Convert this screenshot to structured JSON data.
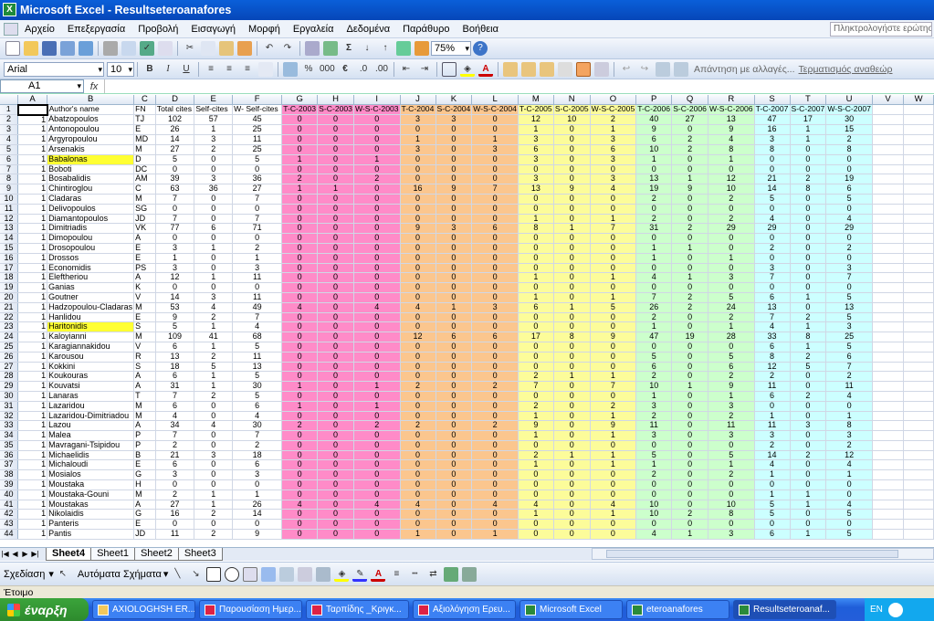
{
  "title": "Microsoft Excel - Resultseteroanafores",
  "menu": [
    "Αρχείο",
    "Επεξεργασία",
    "Προβολή",
    "Εισαγωγή",
    "Μορφή",
    "Εργαλεία",
    "Δεδομένα",
    "Παράθυρο",
    "Βοήθεια"
  ],
  "help_placeholder": "Πληκτρολογήστε ερώτηση",
  "zoom": "75%",
  "font_name": "Arial",
  "font_size": "10",
  "reply_text": "Απάντηση με αλλαγές...",
  "end_review": "Τερματισμός αναθεώρ",
  "namebox": "A1",
  "fx": "fx",
  "columns": [
    "A",
    "B",
    "C",
    "D",
    "E",
    "F",
    "G",
    "H",
    "I",
    "J",
    "K",
    "L",
    "M",
    "N",
    "O",
    "P",
    "Q",
    "R",
    "S",
    "T",
    "U",
    "V",
    "W"
  ],
  "header_row": [
    "",
    "Author's name",
    "FN",
    "Total cites",
    "Self-cites",
    "W-  Self-cites",
    "T-C-2003",
    "S-C-2003",
    "W-S-C-2003",
    "T-C-2004",
    "S-C-2004",
    "W-S-C-2004",
    "T-C-2005",
    "S-C-2005",
    "W-S-C-2005",
    "T-C-2006",
    "S-C-2006",
    "W-S-C-2006",
    "T-C-2007",
    "S-C-2007",
    "W-S-C-2007",
    "",
    ""
  ],
  "rows": [
    [
      "1",
      "Abatzopoulos",
      "TJ",
      "102",
      "57",
      "45",
      "0",
      "0",
      "0",
      "3",
      "3",
      "0",
      "12",
      "10",
      "2",
      "40",
      "27",
      "13",
      "47",
      "17",
      "30"
    ],
    [
      "1",
      "Antonopoulou",
      "E",
      "26",
      "1",
      "25",
      "0",
      "0",
      "0",
      "0",
      "0",
      "0",
      "1",
      "0",
      "1",
      "9",
      "0",
      "9",
      "16",
      "1",
      "15"
    ],
    [
      "1",
      "Argyropoulou",
      "MD",
      "14",
      "3",
      "11",
      "0",
      "0",
      "0",
      "1",
      "0",
      "1",
      "3",
      "0",
      "3",
      "6",
      "2",
      "4",
      "3",
      "1",
      "2"
    ],
    [
      "1",
      "Arsenakis",
      "M",
      "27",
      "2",
      "25",
      "0",
      "0",
      "0",
      "3",
      "0",
      "3",
      "6",
      "0",
      "6",
      "10",
      "2",
      "8",
      "8",
      "0",
      "8"
    ],
    [
      "1",
      "Babalonas",
      "D",
      "5",
      "0",
      "5",
      "1",
      "0",
      "1",
      "0",
      "0",
      "0",
      "3",
      "0",
      "3",
      "1",
      "0",
      "1",
      "0",
      "0",
      "0"
    ],
    [
      "1",
      "Boboti",
      "DC",
      "0",
      "0",
      "0",
      "0",
      "0",
      "0",
      "0",
      "0",
      "0",
      "0",
      "0",
      "0",
      "0",
      "0",
      "0",
      "0",
      "0",
      "0"
    ],
    [
      "1",
      "Bosabalidis",
      "AM",
      "39",
      "3",
      "36",
      "2",
      "0",
      "2",
      "0",
      "0",
      "0",
      "3",
      "0",
      "3",
      "13",
      "1",
      "12",
      "21",
      "2",
      "19"
    ],
    [
      "1",
      "Chintiroglou",
      "C",
      "63",
      "36",
      "27",
      "1",
      "1",
      "0",
      "16",
      "9",
      "7",
      "13",
      "9",
      "4",
      "19",
      "9",
      "10",
      "14",
      "8",
      "6"
    ],
    [
      "1",
      "Cladaras",
      "M",
      "7",
      "0",
      "7",
      "0",
      "0",
      "0",
      "0",
      "0",
      "0",
      "0",
      "0",
      "0",
      "2",
      "0",
      "2",
      "5",
      "0",
      "5"
    ],
    [
      "1",
      "Delivopoulos",
      "SG",
      "0",
      "0",
      "0",
      "0",
      "0",
      "0",
      "0",
      "0",
      "0",
      "0",
      "0",
      "0",
      "0",
      "0",
      "0",
      "0",
      "0",
      "0"
    ],
    [
      "1",
      "Diamantopoulos",
      "JD",
      "7",
      "0",
      "7",
      "0",
      "0",
      "0",
      "0",
      "0",
      "0",
      "1",
      "0",
      "1",
      "2",
      "0",
      "2",
      "4",
      "0",
      "4"
    ],
    [
      "1",
      "Dimitriadis",
      "VK",
      "77",
      "6",
      "71",
      "0",
      "0",
      "0",
      "9",
      "3",
      "6",
      "8",
      "1",
      "7",
      "31",
      "2",
      "29",
      "29",
      "0",
      "29"
    ],
    [
      "1",
      "Dimopoulou",
      "A",
      "0",
      "0",
      "0",
      "0",
      "0",
      "0",
      "0",
      "0",
      "0",
      "0",
      "0",
      "0",
      "0",
      "0",
      "0",
      "0",
      "0",
      "0"
    ],
    [
      "1",
      "Drosopoulou",
      "E",
      "3",
      "1",
      "2",
      "0",
      "0",
      "0",
      "0",
      "0",
      "0",
      "0",
      "0",
      "0",
      "1",
      "1",
      "0",
      "2",
      "0",
      "2"
    ],
    [
      "1",
      "Drossos",
      "E",
      "1",
      "0",
      "1",
      "0",
      "0",
      "0",
      "0",
      "0",
      "0",
      "0",
      "0",
      "0",
      "1",
      "0",
      "1",
      "0",
      "0",
      "0"
    ],
    [
      "1",
      "Economidis",
      "PS",
      "3",
      "0",
      "3",
      "0",
      "0",
      "0",
      "0",
      "0",
      "0",
      "0",
      "0",
      "0",
      "0",
      "0",
      "0",
      "3",
      "0",
      "3"
    ],
    [
      "1",
      "Eleftheriou",
      "A",
      "12",
      "1",
      "11",
      "0",
      "0",
      "0",
      "0",
      "0",
      "0",
      "1",
      "0",
      "1",
      "4",
      "1",
      "3",
      "7",
      "0",
      "7"
    ],
    [
      "1",
      "Ganias",
      "K",
      "0",
      "0",
      "0",
      "0",
      "0",
      "0",
      "0",
      "0",
      "0",
      "0",
      "0",
      "0",
      "0",
      "0",
      "0",
      "0",
      "0",
      "0"
    ],
    [
      "1",
      "Goutner",
      "V",
      "14",
      "3",
      "11",
      "0",
      "0",
      "0",
      "0",
      "0",
      "0",
      "1",
      "0",
      "1",
      "7",
      "2",
      "5",
      "6",
      "1",
      "5"
    ],
    [
      "1",
      "Hadzopoulou-Cladaras",
      "M",
      "53",
      "4",
      "49",
      "4",
      "0",
      "4",
      "4",
      "1",
      "3",
      "6",
      "1",
      "5",
      "26",
      "2",
      "24",
      "13",
      "0",
      "13"
    ],
    [
      "1",
      "Hanlidou",
      "E",
      "9",
      "2",
      "7",
      "0",
      "0",
      "0",
      "0",
      "0",
      "0",
      "0",
      "0",
      "0",
      "2",
      "0",
      "2",
      "7",
      "2",
      "5"
    ],
    [
      "1",
      "Haritonidis",
      "S",
      "5",
      "1",
      "4",
      "0",
      "0",
      "0",
      "0",
      "0",
      "0",
      "0",
      "0",
      "0",
      "1",
      "0",
      "1",
      "4",
      "1",
      "3"
    ],
    [
      "1",
      "Kaloyianni",
      "M",
      "109",
      "41",
      "68",
      "0",
      "0",
      "0",
      "12",
      "6",
      "6",
      "17",
      "8",
      "9",
      "47",
      "19",
      "28",
      "33",
      "8",
      "25"
    ],
    [
      "1",
      "Karagiannakidou",
      "V",
      "6",
      "1",
      "5",
      "0",
      "0",
      "0",
      "0",
      "0",
      "0",
      "0",
      "0",
      "0",
      "0",
      "0",
      "0",
      "6",
      "1",
      "5"
    ],
    [
      "1",
      "Karousou",
      "R",
      "13",
      "2",
      "11",
      "0",
      "0",
      "0",
      "0",
      "0",
      "0",
      "0",
      "0",
      "0",
      "5",
      "0",
      "5",
      "8",
      "2",
      "6"
    ],
    [
      "1",
      "Kokkini",
      "S",
      "18",
      "5",
      "13",
      "0",
      "0",
      "0",
      "0",
      "0",
      "0",
      "0",
      "0",
      "0",
      "6",
      "0",
      "6",
      "12",
      "5",
      "7"
    ],
    [
      "1",
      "Koukouras",
      "A",
      "6",
      "1",
      "5",
      "0",
      "0",
      "0",
      "0",
      "0",
      "0",
      "2",
      "1",
      "1",
      "2",
      "0",
      "2",
      "2",
      "0",
      "2"
    ],
    [
      "1",
      "Kouvatsi",
      "A",
      "31",
      "1",
      "30",
      "1",
      "0",
      "1",
      "2",
      "0",
      "2",
      "7",
      "0",
      "7",
      "10",
      "1",
      "9",
      "11",
      "0",
      "11"
    ],
    [
      "1",
      "Lanaras",
      "T",
      "7",
      "2",
      "5",
      "0",
      "0",
      "0",
      "0",
      "0",
      "0",
      "0",
      "0",
      "0",
      "1",
      "0",
      "1",
      "6",
      "2",
      "4"
    ],
    [
      "1",
      "Lazaridou",
      "M",
      "6",
      "0",
      "6",
      "1",
      "0",
      "1",
      "0",
      "0",
      "0",
      "2",
      "0",
      "2",
      "3",
      "0",
      "3",
      "0",
      "0",
      "0"
    ],
    [
      "1",
      "Lazaridou-Dimitriadou",
      "M",
      "4",
      "0",
      "4",
      "0",
      "0",
      "0",
      "0",
      "0",
      "0",
      "1",
      "0",
      "1",
      "2",
      "0",
      "2",
      "1",
      "0",
      "1"
    ],
    [
      "1",
      "Lazou",
      "A",
      "34",
      "4",
      "30",
      "2",
      "0",
      "2",
      "2",
      "0",
      "2",
      "9",
      "0",
      "9",
      "11",
      "0",
      "11",
      "11",
      "3",
      "8"
    ],
    [
      "1",
      "Malea",
      "P",
      "7",
      "0",
      "7",
      "0",
      "0",
      "0",
      "0",
      "0",
      "0",
      "1",
      "0",
      "1",
      "3",
      "0",
      "3",
      "3",
      "0",
      "3"
    ],
    [
      "1",
      "Mavragani-Tsipidou",
      "P",
      "2",
      "0",
      "2",
      "0",
      "0",
      "0",
      "0",
      "0",
      "0",
      "0",
      "0",
      "0",
      "0",
      "0",
      "0",
      "2",
      "0",
      "2"
    ],
    [
      "1",
      "Michaelidis",
      "B",
      "21",
      "3",
      "18",
      "0",
      "0",
      "0",
      "0",
      "0",
      "0",
      "2",
      "1",
      "1",
      "5",
      "0",
      "5",
      "14",
      "2",
      "12"
    ],
    [
      "1",
      "Michaloudi",
      "E",
      "6",
      "0",
      "6",
      "0",
      "0",
      "0",
      "0",
      "0",
      "0",
      "1",
      "0",
      "1",
      "1",
      "0",
      "1",
      "4",
      "0",
      "4"
    ],
    [
      "1",
      "Mosialos",
      "G",
      "3",
      "0",
      "3",
      "0",
      "0",
      "0",
      "0",
      "0",
      "0",
      "0",
      "0",
      "0",
      "2",
      "0",
      "2",
      "1",
      "0",
      "1"
    ],
    [
      "1",
      "Moustaka",
      "H",
      "0",
      "0",
      "0",
      "0",
      "0",
      "0",
      "0",
      "0",
      "0",
      "0",
      "0",
      "0",
      "0",
      "0",
      "0",
      "0",
      "0",
      "0"
    ],
    [
      "1",
      "Moustaka-Gouni",
      "M",
      "2",
      "1",
      "1",
      "0",
      "0",
      "0",
      "0",
      "0",
      "0",
      "0",
      "0",
      "0",
      "0",
      "0",
      "0",
      "1",
      "1",
      "0"
    ],
    [
      "1",
      "Moustakas",
      "A",
      "27",
      "1",
      "26",
      "4",
      "0",
      "4",
      "4",
      "0",
      "4",
      "4",
      "0",
      "4",
      "10",
      "0",
      "10",
      "5",
      "1",
      "4"
    ],
    [
      "1",
      "Nikolaidis",
      "G",
      "16",
      "2",
      "14",
      "0",
      "0",
      "0",
      "0",
      "0",
      "0",
      "1",
      "0",
      "1",
      "10",
      "2",
      "8",
      "5",
      "0",
      "5"
    ],
    [
      "1",
      "Panteris",
      "E",
      "0",
      "0",
      "0",
      "0",
      "0",
      "0",
      "0",
      "0",
      "0",
      "0",
      "0",
      "0",
      "0",
      "0",
      "0",
      "0",
      "0",
      "0"
    ],
    [
      "1",
      "Pantis",
      "JD",
      "11",
      "2",
      "9",
      "0",
      "0",
      "0",
      "1",
      "0",
      "1",
      "0",
      "0",
      "0",
      "4",
      "1",
      "3",
      "6",
      "1",
      "5"
    ]
  ],
  "row_numbers": [
    "1",
    "2",
    "3",
    "4",
    "5",
    "6",
    "7",
    "8",
    "9",
    "10",
    "11",
    "12",
    "13",
    "14",
    "15",
    "16",
    "17",
    "18",
    "19",
    "20",
    "21",
    "22",
    "23",
    "24",
    "25",
    "26",
    "27",
    "28",
    "29",
    "30",
    "31",
    "32",
    "33",
    "34",
    "35",
    "36",
    "37",
    "38",
    "39",
    "40",
    "41",
    "42",
    "43",
    "44"
  ],
  "highlight_rows": [
    6,
    23
  ],
  "sheets": [
    "Sheet4",
    "Sheet1",
    "Sheet2",
    "Sheet3"
  ],
  "active_sheet": "Sheet4",
  "drawing": {
    "draw": "Σχεδίαση",
    "autoshapes": "Αυτόματα Σχήματα"
  },
  "status": "Έτοιμο",
  "start": "έναρξη",
  "tasks": [
    "AXIOLOGHSH ER...",
    "Παρουσίαση Ημερ...",
    "Ταρπίδης _Κριγκ...",
    "Αξιολόγηση Ερευ...",
    "Microsoft Excel",
    "eteroanafores",
    "Resultseteroanaf..."
  ],
  "active_task": "Resultseteroanaf...",
  "lang": "EN",
  "colors": {
    "pink": "#ff8bc8",
    "orange": "#fbc68e",
    "yellow": "#fcfc9a",
    "green": "#ccffcc",
    "cyan": "#ccffff",
    "highlight": "#ffff33",
    "title_blue": "#0a5fd9"
  }
}
